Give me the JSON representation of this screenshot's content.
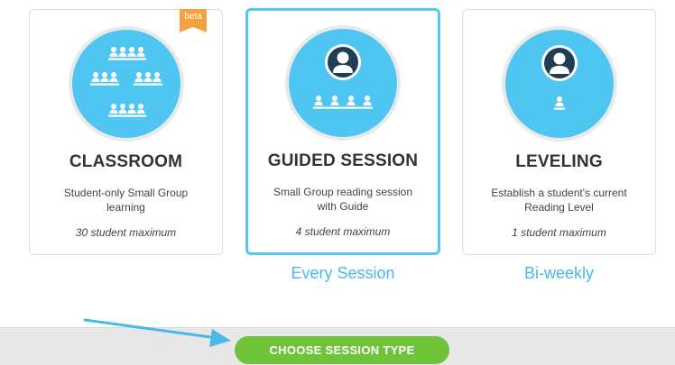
{
  "cards": [
    {
      "id": "classroom",
      "title": "CLASSROOM",
      "description": "Student-only Small Group learning",
      "max": "30 student maximum",
      "badge": "beta",
      "selected": false
    },
    {
      "id": "guided",
      "title": "GUIDED SESSION",
      "description": "Small Group reading session with Guide",
      "max": "4 student maximum",
      "selected": true
    },
    {
      "id": "leveling",
      "title": "LEVELING",
      "description": "Establish a student's current Reading Level",
      "max": "1 student maximum",
      "selected": false
    }
  ],
  "annotations": {
    "guided": "Every Session",
    "leveling": "Bi-weekly"
  },
  "footer": {
    "button_label": "CHOOSE SESSION TYPE"
  },
  "colors": {
    "accent_blue": "#4fc6f1",
    "selected_border": "#56c5ef",
    "button_green": "#6fc43a",
    "badge_orange": "#f3a33d",
    "annotation_blue": "#4ab8ea"
  },
  "icons": {
    "classroom": "students-group-icon",
    "guided": "guide-with-students-icon",
    "leveling": "guide-with-student-icon",
    "arrow": "pointer-arrow-icon"
  }
}
